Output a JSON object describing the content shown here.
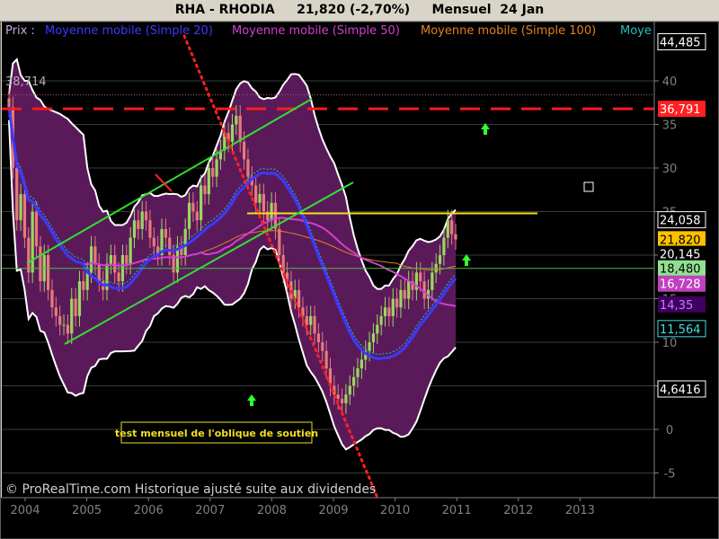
{
  "chart_data": {
    "type": "candlestick",
    "title": "RHA - RHODIA     21,820 (-2,70%)     Mensuel  24 Jan",
    "legend": [
      {
        "label": "Prix",
        "color": "#c8a8d8"
      },
      {
        "label": "Moyenne mobile (Simple 20)",
        "color": "#3a3aff"
      },
      {
        "label": "Moyenne mobile (Simple 50)",
        "color": "#d040d0"
      },
      {
        "label": "Moyenne mobile (Simple 100)",
        "color": "#e08020"
      },
      {
        "label": "Moye",
        "color": "#20c0c0"
      }
    ],
    "x_ticks": [
      "2004",
      "2005",
      "2006",
      "2007",
      "2008",
      "2009",
      "2010",
      "2011",
      "2012",
      "2013"
    ],
    "y_ticks": [
      "40",
      "35",
      "30",
      "25",
      "20",
      "15",
      "10",
      "5",
      "0",
      "-5"
    ],
    "ylim": [
      -7,
      48
    ],
    "price_labels": [
      {
        "value": 44.485,
        "text": "44,485",
        "bg": "#000000",
        "fg": "#ffffff",
        "border": "#ffffff"
      },
      {
        "value": 36.791,
        "text": "36,791",
        "bg": "#ff2020",
        "fg": "#ffffff"
      },
      {
        "value": 24.058,
        "text": "24,058",
        "bg": "#000000",
        "fg": "#ffffff",
        "border": "#ffffff"
      },
      {
        "value": 21.82,
        "text": "21,820",
        "bg": "#ffc000",
        "fg": "#000000"
      },
      {
        "value": 20.145,
        "text": "20,145",
        "bg": "#000000",
        "fg": "#ffffff"
      },
      {
        "value": 18.48,
        "text": "18,480",
        "bg": "#90e090",
        "fg": "#000000"
      },
      {
        "value": 16.728,
        "text": "16,728",
        "bg": "#c040c0",
        "fg": "#ffffff"
      },
      {
        "value": 14.35,
        "text": "14,35",
        "bg": "#400060",
        "fg": "#c080ff"
      },
      {
        "value": 11.564,
        "text": "11,564",
        "bg": "#000000",
        "fg": "#40e0e0",
        "border": "#40e0e0"
      },
      {
        "value": 4.6416,
        "text": "4,6416",
        "bg": "#000000",
        "fg": "#ffffff",
        "border": "#ffffff"
      }
    ],
    "inner_label": {
      "text": "38,714",
      "value": 38.714
    },
    "annotation": "test mensuel de l'oblique de soutien",
    "footer": "© ProRealTime.com Historique ajusté suite aux dividendes",
    "levels": {
      "resistance_dashed": 36.791,
      "horizontal_green": 18.48,
      "horizontal_yellow": 24.8
    },
    "closes": [
      37,
      30,
      24,
      27,
      22,
      18,
      25,
      21,
      17,
      20,
      16,
      14,
      13,
      12,
      12,
      11,
      15,
      13,
      17,
      16,
      18,
      21,
      19,
      17,
      16,
      19,
      20,
      18,
      17,
      20,
      19,
      22,
      24,
      23,
      25,
      24,
      22,
      21,
      20,
      23,
      22,
      20,
      18,
      21,
      20,
      23,
      26,
      25,
      24,
      28,
      27,
      30,
      29,
      31,
      32,
      34,
      33,
      35,
      36,
      33,
      31,
      29,
      28,
      26,
      27,
      25,
      24,
      26,
      23,
      20,
      18,
      17,
      15,
      16,
      14,
      13,
      12,
      13,
      11,
      10,
      9,
      7,
      5,
      4,
      3.5,
      3,
      4,
      5,
      6,
      7,
      8,
      9,
      10,
      11,
      12,
      13,
      14,
      13,
      15,
      14,
      16,
      15,
      17,
      16,
      18,
      17,
      15,
      16,
      18,
      19,
      20,
      22,
      24,
      22.4,
      21.8
    ]
  }
}
